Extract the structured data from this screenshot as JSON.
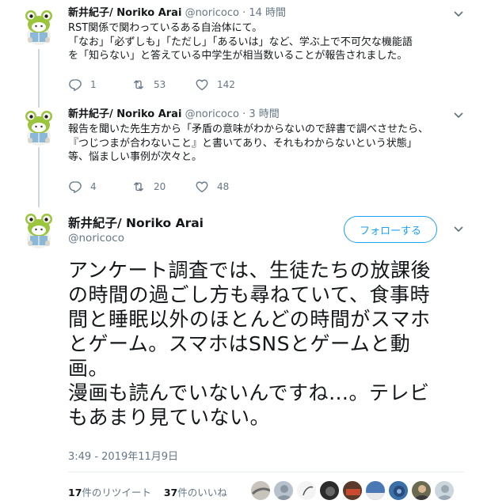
{
  "tweets": [
    {
      "name": "新井紀子/ Noriko Arai",
      "handle": "@noricoco",
      "sep": "·",
      "time": "14 時間",
      "lines": [
        "RST関係で関わっているある自治体にて。",
        "「なお」「必ずしも」「ただし」「あるいは」など、学ぶ上で不可欠な機能語",
        "を「知らない」と答えている中学生が相当数いることが報告されました。"
      ],
      "replies": "1",
      "retweets": "53",
      "likes": "142"
    },
    {
      "name": "新井紀子/ Noriko Arai",
      "handle": "@noricoco",
      "sep": "·",
      "time": "3 時間",
      "lines": [
        "報告を聞いた先生方から「矛盾の意味がわからないので辞書で調べさせたら、",
        "『つじつまが合わないこと』と書いてあり、それもわからないという状態」",
        "等、悩ましい事例が次々と。"
      ],
      "replies": "4",
      "retweets": "20",
      "likes": "48"
    }
  ],
  "main": {
    "name": "新井紀子/ Noriko Arai",
    "handle": "@noricoco",
    "follow_label": "フォローする",
    "lines": [
      "アンケート調査では、生徒たちの放課後",
      "の時間の過ごし方も尋ねていて、食事時",
      "間と睡眠以外のほとんどの時間がスマホ",
      "とゲーム。スマホはSNSとゲームと動",
      "画。",
      "漫画も読んでいないんですね…。テレビ",
      "もあまり見ていない。"
    ],
    "date": "3:49 - 2019年11月9日",
    "retweet_count": "17",
    "retweet_label": "件のリツイート",
    "like_count": "37",
    "like_label": "件のいいね"
  },
  "icons": {
    "reply": "reply-icon",
    "retweet": "retweet-icon",
    "like": "heart-icon",
    "more": "chevron-down-icon"
  },
  "colors": {
    "accent": "#1da1f2",
    "secondary_text": "#657786",
    "divider": "#e6ecf0",
    "avatar_frog": "#9bc53d"
  }
}
